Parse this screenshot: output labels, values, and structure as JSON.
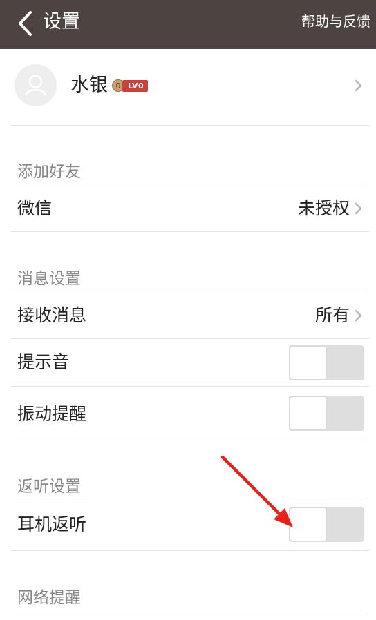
{
  "header": {
    "title": "设置",
    "help_label": "帮助与反馈"
  },
  "profile": {
    "name": "水银",
    "coin_count": "0",
    "level": "LV0"
  },
  "sections": [
    {
      "label": "添加好友",
      "rows": [
        {
          "label": "微信",
          "value": "未授权"
        }
      ]
    },
    {
      "label": "消息设置",
      "rows": [
        {
          "label": "接收消息",
          "value": "所有"
        },
        {
          "label": "提示音",
          "toggle_on": false
        },
        {
          "label": "振动提醒",
          "toggle_on": false
        }
      ]
    },
    {
      "label": "返听设置",
      "rows": [
        {
          "label": "耳机返听",
          "toggle_on": false
        }
      ]
    },
    {
      "label": "网络提醒"
    }
  ],
  "colors": {
    "header_bg": "#4d4340",
    "toggle_off_track": "#dedede",
    "annotation_arrow": "#e8221b",
    "level_badge": "#c9413a"
  }
}
